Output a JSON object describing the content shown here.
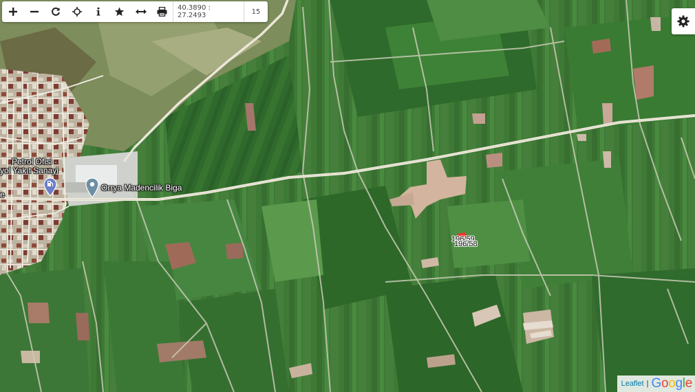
{
  "toolbar": {
    "buttons": [
      {
        "name": "zoom-in-button",
        "icon": "plus-icon"
      },
      {
        "name": "zoom-out-button",
        "icon": "minus-icon"
      },
      {
        "name": "refresh-button",
        "icon": "refresh-icon"
      },
      {
        "name": "locate-button",
        "icon": "crosshair-icon"
      },
      {
        "name": "info-button",
        "icon": "info-icon"
      },
      {
        "name": "favorite-button",
        "icon": "star-icon"
      },
      {
        "name": "measure-button",
        "icon": "measure-icon"
      },
      {
        "name": "print-button",
        "icon": "printer-icon"
      }
    ],
    "coordinates": "40.3890 : 27.2493",
    "zoom": "15"
  },
  "map": {
    "labels": {
      "petrol_line1": "Petrol Ofisi -",
      "petrol_line2": "yol Yakıt Sanayi",
      "company": "Orrya Madencilik Biga",
      "edge_fragment": "e"
    },
    "parcel": {
      "label_top": "196/59",
      "label_bottom": "196/58"
    }
  },
  "settings": {
    "icon": "gear-icon"
  },
  "attribution": {
    "leaflet": "Leaflet",
    "separator": "|",
    "google": "Google"
  },
  "colors": {
    "fields_dark": "#2f6a2c",
    "fields_light": "#5c9a4a",
    "road": "#e8e2d2",
    "fuel_pin": "#6b7fc9",
    "place_pin": "#6e8fa6",
    "leaflet_link": "#0078a8"
  }
}
